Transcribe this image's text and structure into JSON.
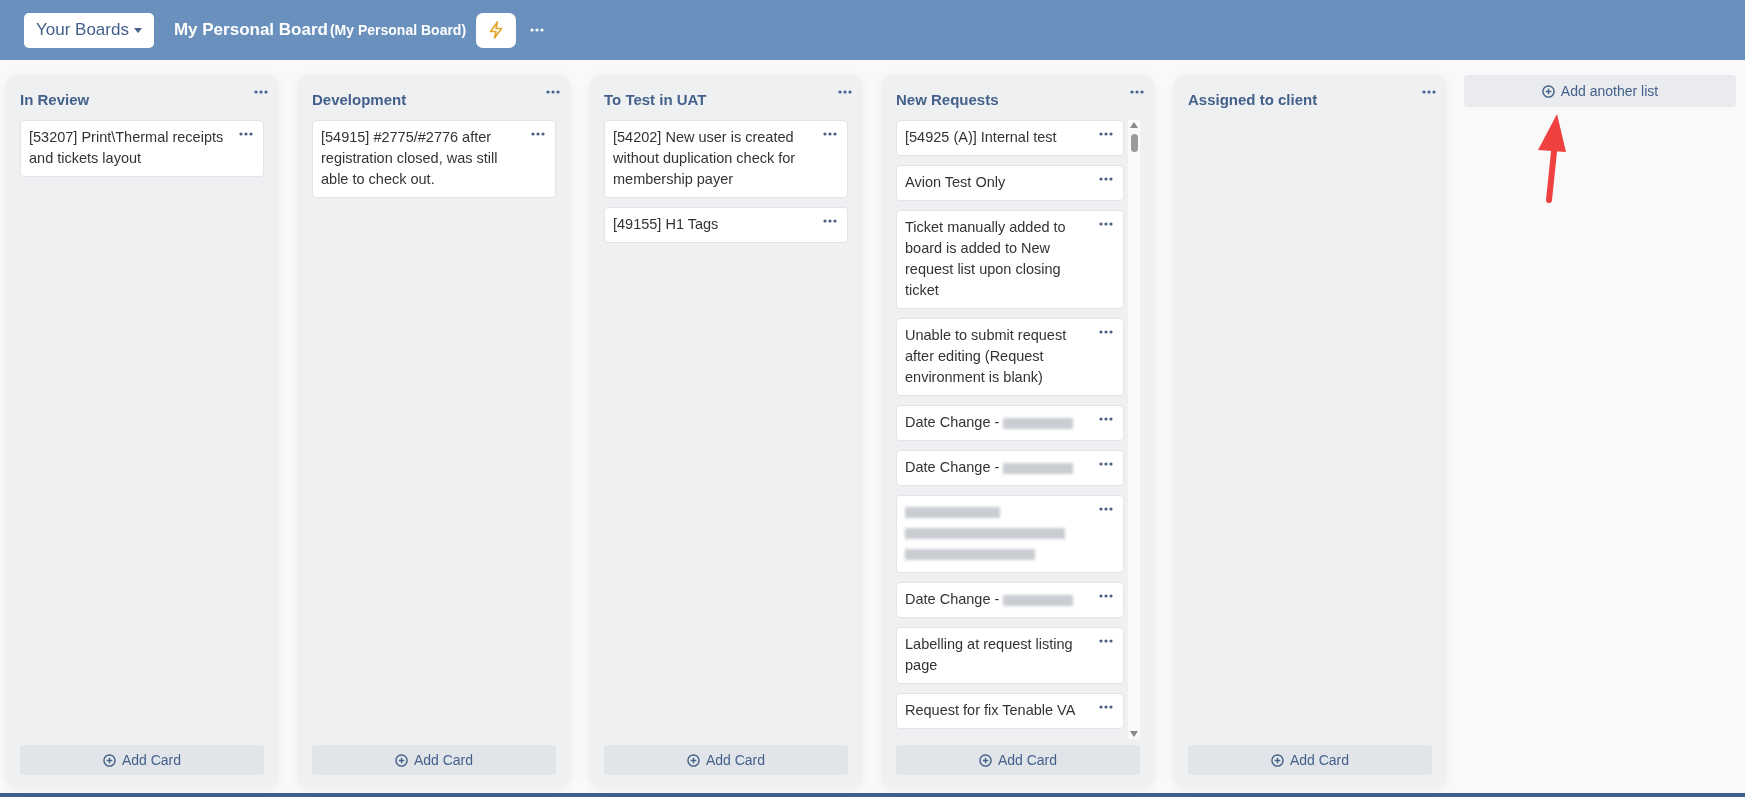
{
  "header": {
    "boards_button": "Your Boards",
    "board_title": "My Personal Board",
    "board_subtitle": "(My Personal Board)"
  },
  "lists": [
    {
      "title": "In Review",
      "cards": [
        {
          "title": "[53207] Print\\Thermal receipts and tickets layout",
          "redacted": false
        }
      ],
      "add_button": "Add Card"
    },
    {
      "title": "Development",
      "cards": [
        {
          "title": "[54915] #2775/#2776 after registration closed, was still able to check out.",
          "redacted": false
        }
      ],
      "add_button": "Add Card"
    },
    {
      "title": "To Test in UAT",
      "cards": [
        {
          "title": "[54202] New user is created without duplication check for membership payer",
          "redacted": false
        },
        {
          "title": "[49155] H1 Tags",
          "redacted": false
        }
      ],
      "add_button": "Add Card"
    },
    {
      "title": "New Requests",
      "scrollable": true,
      "cards": [
        {
          "title": "[54925 (A)] Internal test",
          "redacted": false
        },
        {
          "title": "Avion Test Only",
          "redacted": false
        },
        {
          "title": "Ticket manually added to board is added to New request list upon closing ticket",
          "redacted": false
        },
        {
          "title": "Unable to submit request after editing (Request environment is blank)",
          "redacted": false
        },
        {
          "title": "Date Change -",
          "redacted": true
        },
        {
          "title": "Date Change -",
          "redacted": true
        },
        {
          "redacted": true
        },
        {
          "title": "Date Change -",
          "redacted": true
        },
        {
          "title": "Labelling at request listing page",
          "redacted": false
        },
        {
          "title": "Request for fix Tenable VA",
          "redacted": false
        }
      ],
      "add_button": "Add Card"
    },
    {
      "title": "Assigned to client",
      "add_button": "Add Card"
    }
  ],
  "add_list_button": "Add another list"
}
